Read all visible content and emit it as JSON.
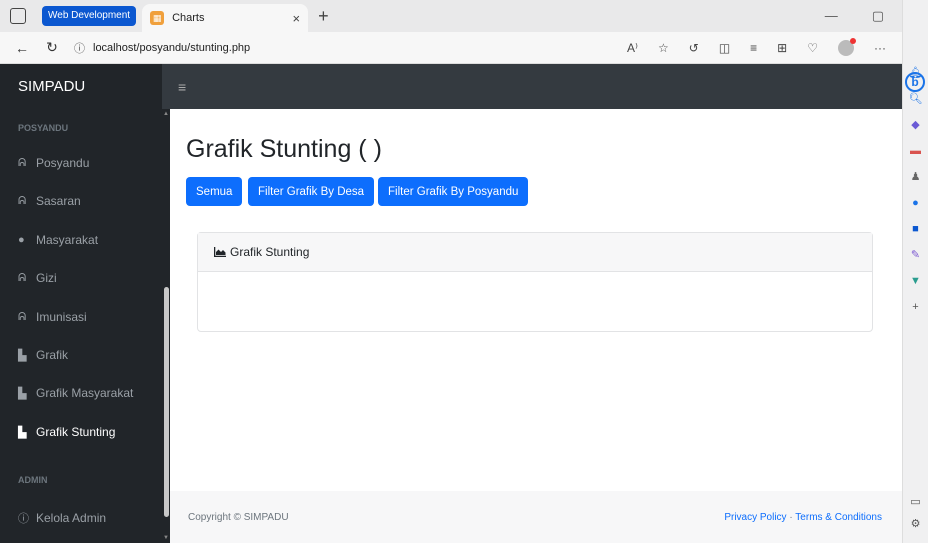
{
  "browser": {
    "tab_group": "Web Development",
    "active_tab_title": "Charts",
    "url": "localhost/posyandu/stunting.php",
    "tab_close_glyph": "×",
    "new_tab_glyph": "+"
  },
  "app": {
    "brand": "SIMPADU",
    "sidebar": {
      "section_posyandu": "POSYANDU",
      "section_admin": "ADMIN",
      "items": [
        {
          "label": "Posyandu",
          "icon": "stethoscope-icon"
        },
        {
          "label": "Sasaran",
          "icon": "stethoscope-icon"
        },
        {
          "label": "Masyarakat",
          "icon": "user-icon"
        },
        {
          "label": "Gizi",
          "icon": "stethoscope-icon"
        },
        {
          "label": "Imunisasi",
          "icon": "stethoscope-icon"
        },
        {
          "label": "Grafik",
          "icon": "area-chart-icon"
        },
        {
          "label": "Grafik Masyarakat",
          "icon": "area-chart-icon"
        },
        {
          "label": "Grafik Stunting",
          "icon": "area-chart-icon"
        }
      ],
      "admin_items": [
        {
          "label": "Kelola Admin",
          "icon": "info-icon"
        }
      ]
    },
    "page_title": "Grafik Stunting ( )",
    "buttons": {
      "semua": "Semua",
      "filter_desa": "Filter Grafik By Desa",
      "filter_posyandu": "Filter Grafik By Posyandu"
    },
    "card_title": "Grafik Stunting",
    "footer": {
      "copyright": "Copyright © SIMPADU",
      "privacy": "Privacy Policy",
      "separator": "·",
      "terms": "Terms & Conditions"
    }
  },
  "colors": {
    "primary": "#0d6efd",
    "sidebar_bg": "#212529",
    "topbar_bg": "#343a40"
  }
}
